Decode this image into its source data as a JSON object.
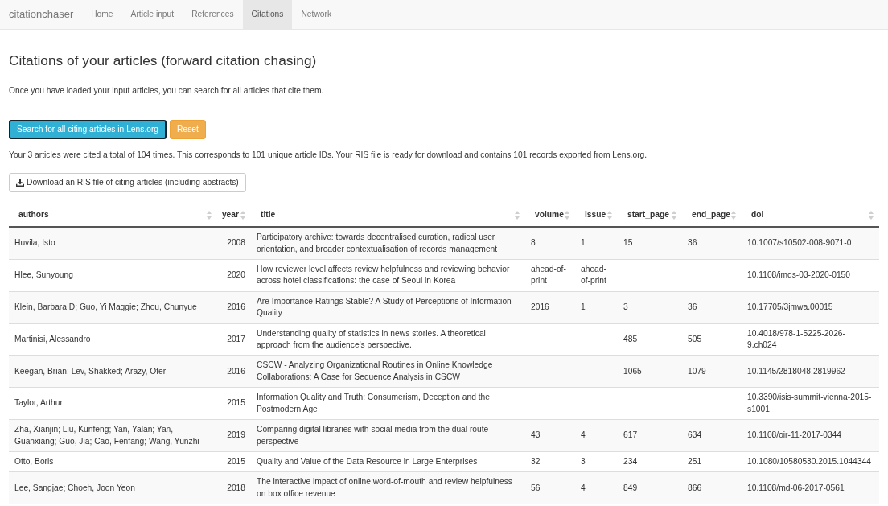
{
  "navbar": {
    "brand": "citationchaser",
    "tabs": [
      {
        "label": "Home",
        "selected": false
      },
      {
        "label": "Article input",
        "selected": false
      },
      {
        "label": "References",
        "selected": false
      },
      {
        "label": "Citations",
        "selected": true
      },
      {
        "label": "Network",
        "selected": false
      }
    ]
  },
  "heading": "Citations of your articles (forward citation chasing)",
  "intro": "Once you have loaded your input articles, you can search for all articles that cite them.",
  "buttons": [
    {
      "label": "Search for all citing articles in Lens.org",
      "kind": "info",
      "focused": true
    },
    {
      "label": "Reset",
      "kind": "warning",
      "focused": false
    }
  ],
  "summary": "Your 3 articles were cited a total of 104 times. This corresponds to 101 unique article IDs. Your RIS file is ready for download and contains 101 records exported from Lens.org.",
  "download_button": {
    "label": "Download an RIS file of citing articles (including abstracts)"
  },
  "table": {
    "columns": [
      {
        "label": "authors",
        "kind": "text"
      },
      {
        "label": "year",
        "kind": "number"
      },
      {
        "label": "title",
        "kind": "text"
      },
      {
        "label": "volume",
        "kind": "text"
      },
      {
        "label": "issue",
        "kind": "text"
      },
      {
        "label": "start_page",
        "kind": "text"
      },
      {
        "label": "end_page",
        "kind": "text"
      },
      {
        "label": "doi",
        "kind": "text"
      }
    ],
    "rows": [
      {
        "authors": "Huvila, Isto",
        "year": "2008",
        "title": "Participatory archive: towards decentralised curation, radical user orientation, and broader contextualisation of records management",
        "volume": "8",
        "issue": "1",
        "start_page": "15",
        "end_page": "36",
        "doi": "10.1007/s10502-008-9071-0"
      },
      {
        "authors": "Hlee, Sunyoung",
        "year": "2020",
        "title": "How reviewer level affects review helpfulness and reviewing behavior across hotel classifications: the case of Seoul in Korea",
        "volume": "ahead-of-print",
        "issue": "ahead-of-print",
        "doi": "10.1108/imds-03-2020-0150"
      },
      {
        "authors": "Klein, Barbara D; Guo, Yi Maggie; Zhou, Chunyue",
        "year": "2016",
        "title": "Are Importance Ratings Stable? A Study of Perceptions of Information Quality",
        "volume": "2016",
        "issue": "1",
        "start_page": "3",
        "end_page": "36",
        "doi": "10.17705/3jmwa.00015"
      },
      {
        "authors": "Martinisi, Alessandro",
        "year": "2017",
        "title": "Understanding quality of statistics in news stories. A theoretical approach from the audience's perspective.",
        "start_page": "485",
        "end_page": "505",
        "doi": "10.4018/978-1-5225-2026-9.ch024"
      },
      {
        "authors": "Keegan, Brian; Lev, Shakked; Arazy, Ofer",
        "year": "2016",
        "title": "CSCW - Analyzing Organizational Routines in Online Knowledge Collaborations: A Case for Sequence Analysis in CSCW",
        "start_page": "1065",
        "end_page": "1079",
        "doi": "10.1145/2818048.2819962"
      },
      {
        "authors": "Taylor, Arthur",
        "year": "2015",
        "title": "Information Quality and Truth: Consumerism, Deception and the Postmodern Age",
        "doi": "10.3390/isis-summit-vienna-2015-s1001"
      },
      {
        "authors": "Zha, Xianjin; Liu, Kunfeng; Yan, Yalan; Yan, Guanxiang; Guo, Jia; Cao, Fenfang; Wang, Yunzhi",
        "year": "2019",
        "title": "Comparing digital libraries with social media from the dual route perspective",
        "volume": "43",
        "issue": "4",
        "start_page": "617",
        "end_page": "634",
        "doi": "10.1108/oir-11-2017-0344"
      },
      {
        "authors": "Otto, Boris",
        "year": "2015",
        "title": "Quality and Value of the Data Resource in Large Enterprises",
        "volume": "32",
        "issue": "3",
        "start_page": "234",
        "end_page": "251",
        "doi": "10.1080/10580530.2015.1044344"
      },
      {
        "authors": "Lee, Sangjae; Choeh, Joon Yeon",
        "year": "2018",
        "title": "The interactive impact of online word-of-mouth and review helpfulness on box office revenue",
        "volume": "56",
        "issue": "4",
        "start_page": "849",
        "end_page": "866",
        "doi": "10.1108/md-06-2017-0561"
      }
    ]
  }
}
